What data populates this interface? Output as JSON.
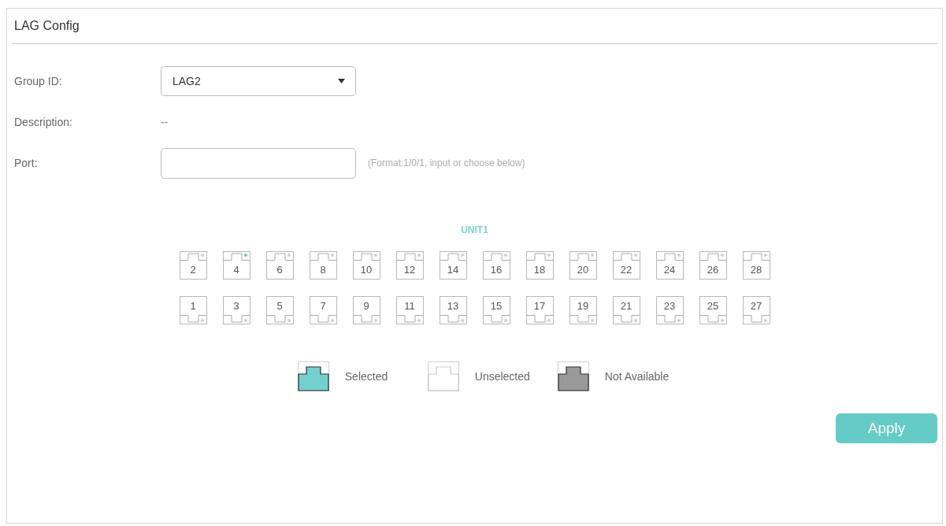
{
  "panel": {
    "title": "LAG Config"
  },
  "form": [
    {
      "kind": "select",
      "label": "Group ID:",
      "value": "LAG2"
    },
    {
      "kind": "text",
      "label": "Description:",
      "value": "--"
    },
    {
      "kind": "input",
      "label": "Port:",
      "hint": "(Format:1/0/1, input or choose below)"
    }
  ],
  "unit": {
    "label": "UNIT1",
    "rows": [
      {
        "kind": "upper",
        "ports": [
          {
            "label": "2",
            "selected": false,
            "link_up": false
          },
          {
            "label": "4",
            "selected": false,
            "link_up": true
          },
          {
            "label": "6",
            "selected": false,
            "link_up": false
          },
          {
            "label": "8",
            "selected": false,
            "link_up": false
          },
          {
            "label": "10",
            "selected": false,
            "link_up": false
          },
          {
            "label": "12",
            "selected": false,
            "link_up": false
          },
          {
            "label": "14",
            "selected": false,
            "link_up": false
          },
          {
            "label": "16",
            "selected": false,
            "link_up": false
          },
          {
            "label": "18",
            "selected": false,
            "link_up": false
          },
          {
            "label": "20",
            "selected": false,
            "link_up": false
          },
          {
            "label": "22",
            "selected": false,
            "link_up": false
          },
          {
            "label": "24",
            "selected": false,
            "link_up": false
          },
          {
            "label": "26",
            "selected": false,
            "link_up": false
          },
          {
            "label": "28",
            "selected": false,
            "link_up": false
          }
        ]
      },
      {
        "kind": "lower",
        "ports": [
          {
            "label": "1",
            "selected": false,
            "link_up": false
          },
          {
            "label": "3",
            "selected": false,
            "link_up": false
          },
          {
            "label": "5",
            "selected": false,
            "link_up": false
          },
          {
            "label": "7",
            "selected": false,
            "link_up": false
          },
          {
            "label": "9",
            "selected": false,
            "link_up": false
          },
          {
            "label": "11",
            "selected": false,
            "link_up": false
          },
          {
            "label": "13",
            "selected": false,
            "link_up": false
          },
          {
            "label": "15",
            "selected": false,
            "link_up": false
          },
          {
            "label": "17",
            "selected": false,
            "link_up": false
          },
          {
            "label": "19",
            "selected": false,
            "link_up": false
          },
          {
            "label": "21",
            "selected": false,
            "link_up": false
          },
          {
            "label": "23",
            "selected": false,
            "link_up": false
          },
          {
            "label": "25",
            "selected": false,
            "link_up": false
          },
          {
            "label": "27",
            "selected": false,
            "link_up": false
          }
        ]
      }
    ]
  },
  "legend": [
    {
      "kind": "selected",
      "label": "Selected"
    },
    {
      "kind": "unselected",
      "label": "Unselected"
    },
    {
      "kind": "unavailable",
      "label": "Not Available"
    }
  ],
  "buttons": [
    {
      "label": "Apply"
    }
  ]
}
